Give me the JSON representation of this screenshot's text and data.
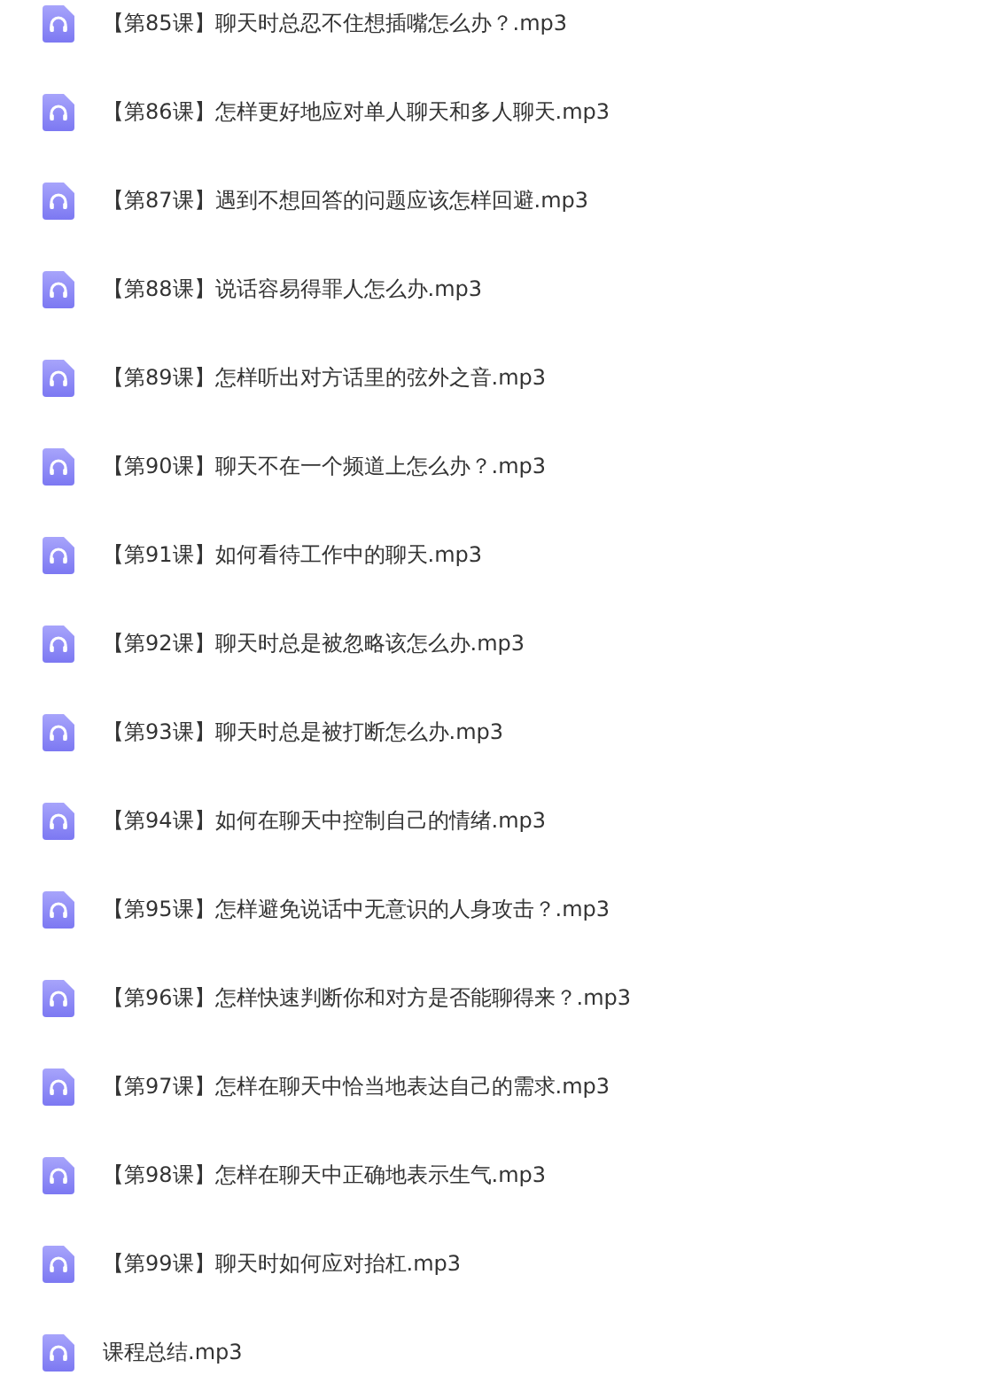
{
  "files": [
    {
      "name": "【第85课】聊天时总忍不住想插嘴怎么办？.mp3"
    },
    {
      "name": "【第86课】怎样更好地应对单人聊天和多人聊天.mp3"
    },
    {
      "name": "【第87课】遇到不想回答的问题应该怎样回避.mp3"
    },
    {
      "name": "【第88课】说话容易得罪人怎么办.mp3"
    },
    {
      "name": "【第89课】怎样听出对方话里的弦外之音.mp3"
    },
    {
      "name": "【第90课】聊天不在一个频道上怎么办？.mp3"
    },
    {
      "name": "【第91课】如何看待工作中的聊天.mp3"
    },
    {
      "name": "【第92课】聊天时总是被忽略该怎么办.mp3"
    },
    {
      "name": "【第93课】聊天时总是被打断怎么办.mp3"
    },
    {
      "name": "【第94课】如何在聊天中控制自己的情绪.mp3"
    },
    {
      "name": "【第95课】怎样避免说话中无意识的人身攻击？.mp3"
    },
    {
      "name": "【第96课】怎样快速判断你和对方是否能聊得来？.mp3"
    },
    {
      "name": "【第97课】怎样在聊天中恰当地表达自己的需求.mp3"
    },
    {
      "name": "【第98课】怎样在聊天中正确地表示生气.mp3"
    },
    {
      "name": "【第99课】聊天时如何应对抬杠.mp3"
    },
    {
      "name": "课程总结.mp3"
    }
  ]
}
